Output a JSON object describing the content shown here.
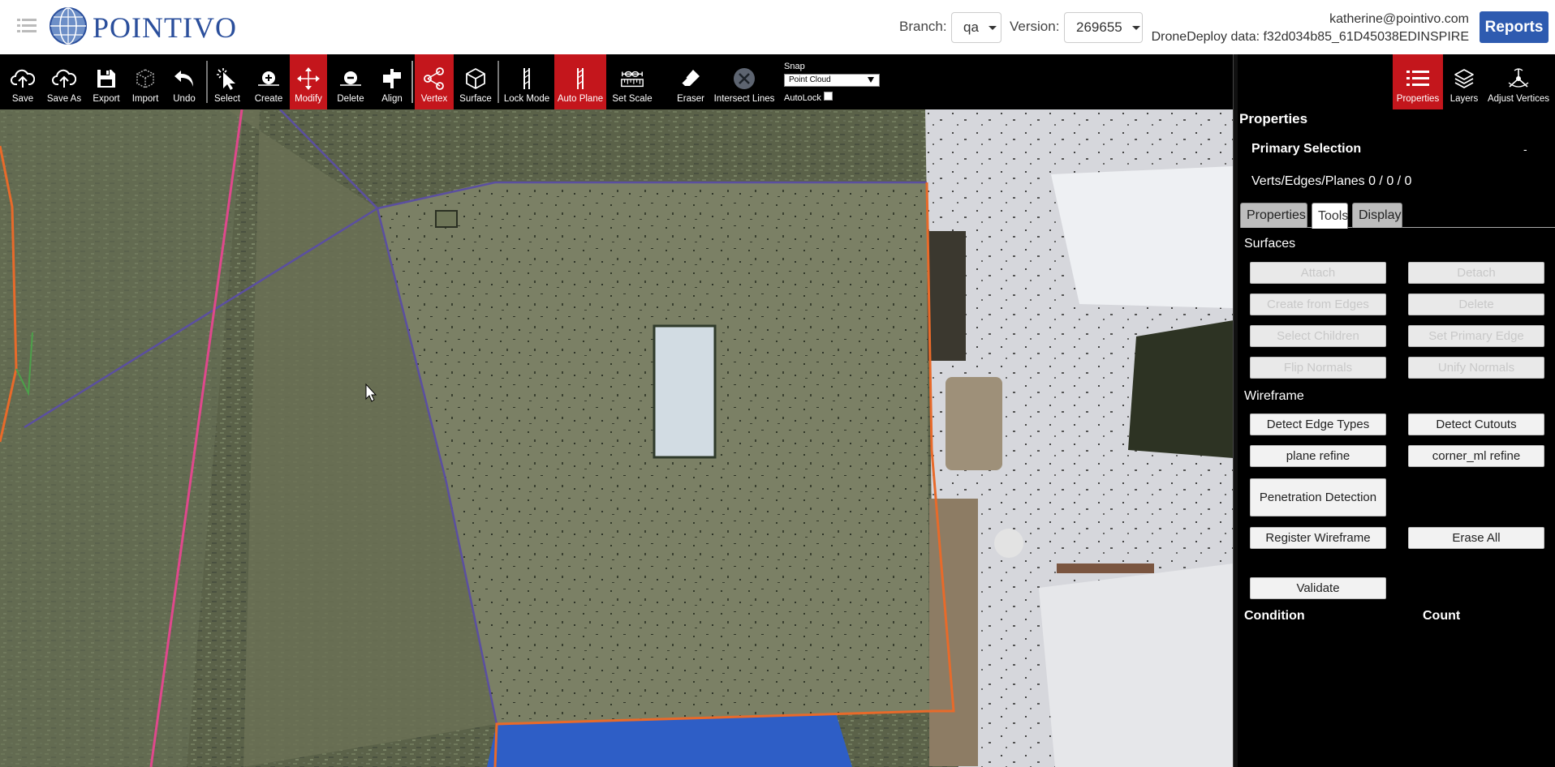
{
  "header": {
    "logo_text": "POINTIVO",
    "branch_label": "Branch:",
    "branch_value": "qa",
    "version_label": "Version:",
    "version_value": "269655",
    "user_email": "katherine@pointivo.com",
    "dronedeploy_text": "DroneDeploy data: f32d034b85_61D45038EDINSPIRE",
    "reports_label": "Reports",
    "accent_color": "#2e5bb0"
  },
  "toolbar": {
    "tools": [
      {
        "label": "Save",
        "icon": "cloud-upload-icon",
        "active": false
      },
      {
        "label": "Save As",
        "icon": "cloud-upload-icon",
        "active": false
      },
      {
        "label": "Export",
        "icon": "floppy-disk-icon",
        "active": false
      },
      {
        "label": "Import",
        "icon": "cube-outline-icon",
        "active": false
      },
      {
        "label": "Undo",
        "icon": "undo-arrow-icon",
        "active": false
      },
      {
        "label": "Select",
        "icon": "cursor-select-icon",
        "active": false
      },
      {
        "label": "Create",
        "icon": "create-plus-icon",
        "active": false
      },
      {
        "label": "Modify",
        "icon": "move-arrows-icon",
        "active": true
      },
      {
        "label": "Delete",
        "icon": "delete-minus-icon",
        "active": false
      },
      {
        "label": "Align",
        "icon": "align-icon",
        "active": false
      },
      {
        "label": "Vertex",
        "icon": "vertex-share-icon",
        "active": true
      },
      {
        "label": "Surface",
        "icon": "cube-icon",
        "active": false
      },
      {
        "label": "Lock Mode",
        "icon": "lock-mode-icon",
        "active": false
      },
      {
        "label": "Auto Plane",
        "icon": "auto-plane-icon",
        "active": true
      },
      {
        "label": "Set Scale",
        "icon": "ruler-icon",
        "active": false
      },
      {
        "label": "Eraser",
        "icon": "eraser-icon",
        "active": false
      },
      {
        "label": "Intersect Lines",
        "icon": "intersect-x-icon",
        "active": false
      }
    ],
    "snap_label": "Snap",
    "snap_value": "Point Cloud",
    "autolock_label": "AutoLock",
    "right_tools": [
      {
        "label": "Properties",
        "icon": "list-icon",
        "active": true
      },
      {
        "label": "Layers",
        "icon": "layers-icon",
        "active": false
      },
      {
        "label": "Adjust Vertices",
        "icon": "adjust-vertices-icon",
        "active": false
      }
    ],
    "active_color": "#c4161c"
  },
  "panel": {
    "title": "Properties",
    "primary_selection": "Primary Selection",
    "primary_value": "-",
    "verts_text": "Verts/Edges/Planes 0 / 0 / 0",
    "tabs": [
      {
        "label": "Properties",
        "active": false
      },
      {
        "label": "Tools",
        "active": true
      },
      {
        "label": "Display",
        "active": false
      }
    ],
    "surfaces_label": "Surfaces",
    "surface_buttons": [
      "Attach",
      "Detach",
      "Create from Edges",
      "Delete",
      "Select Children",
      "Set Primary Edge",
      "Flip Normals",
      "Unify Normals"
    ],
    "wireframe_label": "Wireframe",
    "wireframe_buttons": [
      "Detect Edge Types",
      "Detect Cutouts",
      "plane refine",
      "corner_ml refine",
      "Penetration Detection",
      "Register Wireframe",
      "Erase All",
      "Validate"
    ],
    "condition_label": "Condition",
    "count_label": "Count"
  }
}
